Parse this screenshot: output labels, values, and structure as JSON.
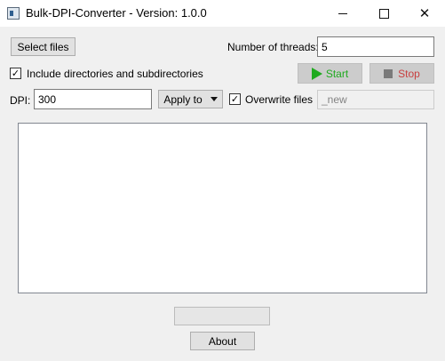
{
  "window": {
    "title": "Bulk-DPI-Converter - Version: 1.0.0",
    "controls": {
      "minimize": "minimize-icon",
      "maximize": "maximize-icon",
      "close": "✕"
    }
  },
  "toolbar": {
    "select_files_label": "Select files",
    "threads_label": "Number of threads:",
    "threads_value": "5",
    "include_dirs_label": "Include directories and subdirectories",
    "include_dirs_checked": true,
    "start_label": "Start",
    "stop_label": "Stop",
    "start_color": "#1faa1f",
    "stop_color": "#c84040"
  },
  "dpi_row": {
    "dpi_label": "DPI:",
    "dpi_value": "300",
    "apply_to_label": "Apply to",
    "overwrite_label": "Overwrite files",
    "overwrite_checked": true,
    "suffix_value": "_new"
  },
  "progress": {
    "value": 0
  },
  "footer": {
    "about_label": "About"
  },
  "check_mark": "✓"
}
